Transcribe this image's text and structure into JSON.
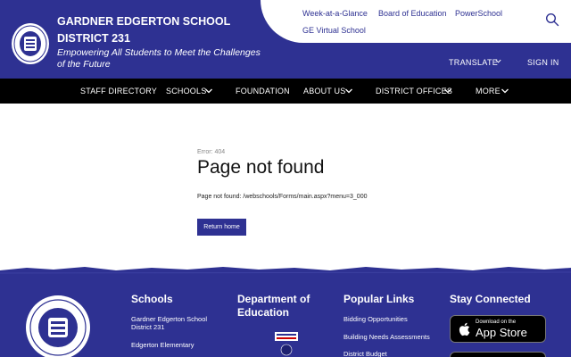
{
  "header": {
    "district_name": "GARDNER EDGERTON SCHOOL DISTRICT 231",
    "tagline": "Empowering All Students to Meet the Challenges of the Future",
    "utility_links": [
      "Week-at-a-Glance",
      "Board of Education",
      "PowerSchool",
      "GE Virtual School"
    ],
    "translate_label": "TRANSLATE",
    "signin_label": "SIGN IN"
  },
  "nav": {
    "items": [
      "STAFF DIRECTORY",
      "SCHOOLS",
      "FOUNDATION",
      "ABOUT US",
      "DISTRICT OFFICES",
      "MORE"
    ]
  },
  "main": {
    "error_code": "Error: 404",
    "title": "Page not found",
    "message": "Page not found: /webschools/Forms/main.aspx?menu=3_000",
    "return_label": "Return home"
  },
  "footer": {
    "schools_heading": "Schools",
    "schools_links": [
      "Gardner Edgerton School District 231",
      "Edgerton Elementary"
    ],
    "doe_heading": "Department of Education",
    "popular_heading": "Popular Links",
    "popular_links": [
      "Bidding Opportunities",
      "Building Needs Assessments",
      "District Budget"
    ],
    "stay_heading": "Stay Connected",
    "appstore_small": "Download on the",
    "appstore_big": "App Store"
  },
  "colors": {
    "brand_blue": "#2e3192",
    "nav_black": "#000000"
  }
}
